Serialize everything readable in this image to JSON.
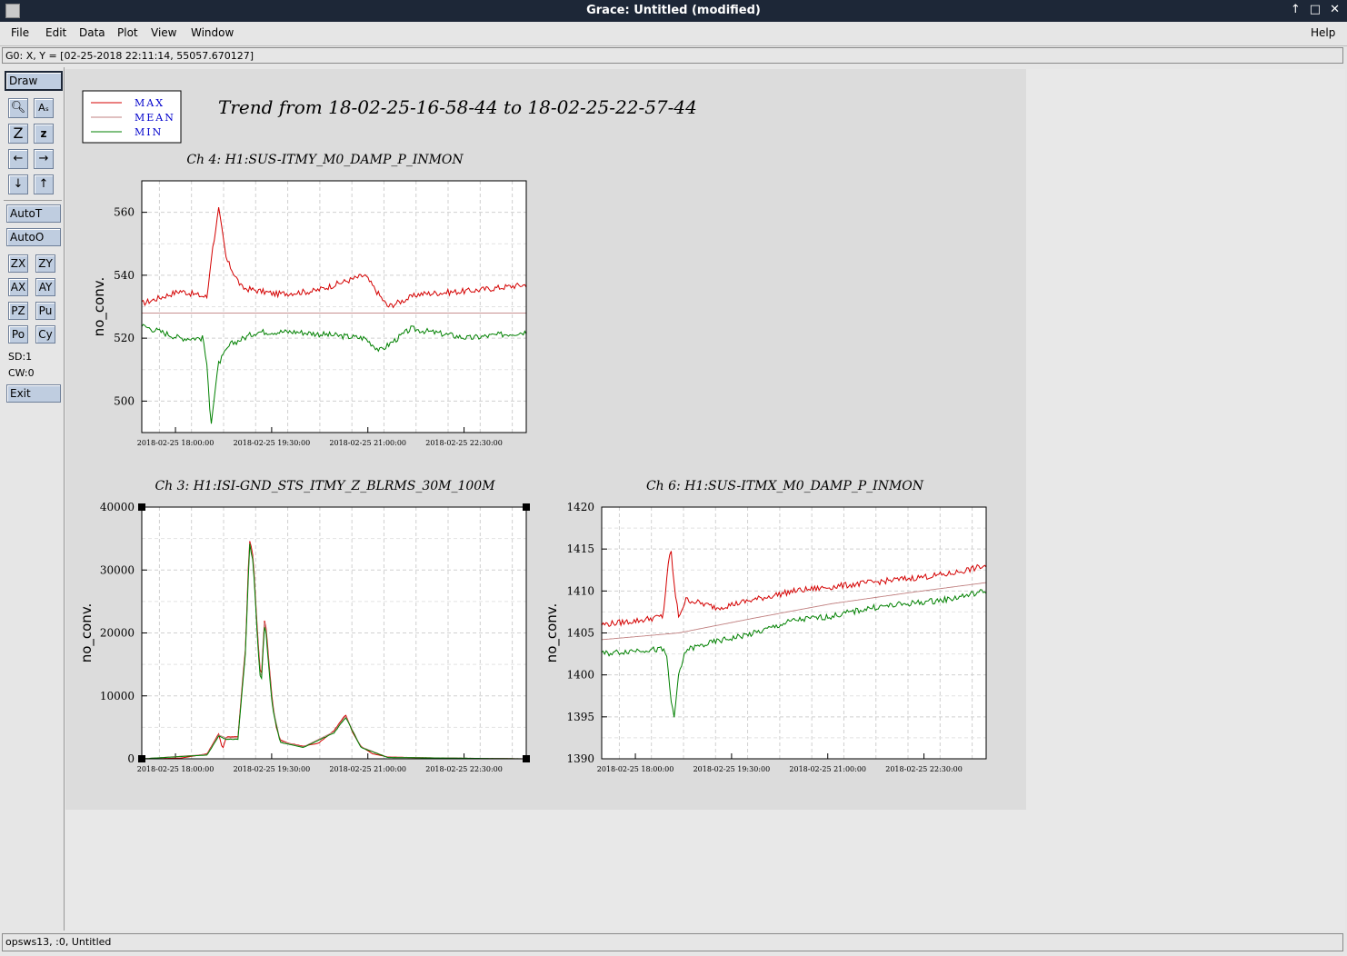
{
  "window": {
    "title": "Grace: Untitled (modified)",
    "controls": [
      "↑",
      "□",
      "✕"
    ]
  },
  "menu": {
    "items": [
      "File",
      "Edit",
      "Data",
      "Plot",
      "View",
      "Window"
    ],
    "help": "Help"
  },
  "locator": "G0: X, Y = [02-25-2018 22:11:14, 55057.670127]",
  "toolbar": {
    "draw": "Draw",
    "autot": "AutoT",
    "autoo": "AutoO",
    "grid_buttons": [
      "ZX",
      "ZY",
      "AX",
      "AY",
      "PZ",
      "Pu",
      "Po",
      "Cy"
    ],
    "sd": "SD:1",
    "cw": "CW:0",
    "exit": "Exit"
  },
  "status": "opsws13, :0, Untitled",
  "legend": {
    "entries": [
      {
        "label": "MAX",
        "color": "#d40000"
      },
      {
        "label": "MEAN",
        "color": "#c08080"
      },
      {
        "label": "MIN",
        "color": "#008000"
      }
    ]
  },
  "page_title": "Trend from 18-02-25-16-58-44 to 18-02-25-22-57-44",
  "chart_data": [
    {
      "type": "line",
      "title": "Ch 4: H1:SUS-ITMY_M0_DAMP_P_INMON",
      "ylabel": "no_conv.",
      "xticks": [
        "2018-02-25 18:00:00",
        "2018-02-25 19:30:00",
        "2018-02-25 21:00:00",
        "2018-02-25 22:30:00"
      ],
      "yticks": [
        500,
        520,
        540,
        560
      ],
      "ylim": [
        490,
        570
      ],
      "xlim": [
        "2018-02-25 16:58:44",
        "2018-02-25 22:57:44"
      ],
      "grid": true,
      "series": [
        {
          "name": "MAX",
          "color": "#d40000",
          "x": [
            0,
            0.1,
            0.17,
            0.18,
            0.2,
            0.22,
            0.26,
            0.35,
            0.45,
            0.58,
            0.64,
            0.72,
            0.85,
            1.0
          ],
          "values": [
            531,
            535,
            533,
            545,
            561,
            545,
            536,
            534,
            535,
            540,
            530,
            534,
            535,
            537
          ]
        },
        {
          "name": "MEAN",
          "color": "#c08080",
          "x": [
            0,
            1.0
          ],
          "values": [
            528,
            528
          ]
        },
        {
          "name": "MIN",
          "color": "#008000",
          "x": [
            0,
            0.1,
            0.16,
            0.17,
            0.18,
            0.2,
            0.23,
            0.3,
            0.4,
            0.58,
            0.62,
            0.7,
            0.85,
            1.0
          ],
          "values": [
            524,
            520,
            520,
            510,
            493,
            512,
            518,
            522,
            522,
            520,
            516,
            523,
            520,
            522
          ]
        }
      ]
    },
    {
      "type": "line",
      "title": "Ch 3: H1:ISI-GND_STS_ITMY_Z_BLRMS_30M_100M",
      "ylabel": "no_conv.",
      "xticks": [
        "2018-02-25 18:00:00",
        "2018-02-25 19:30:00",
        "2018-02-25 21:00:00",
        "2018-02-25 22:30:00"
      ],
      "yticks": [
        0,
        10000,
        20000,
        30000,
        40000
      ],
      "ylim": [
        0,
        40000
      ],
      "xlim": [
        "2018-02-25 16:58:44",
        "2018-02-25 22:57:44"
      ],
      "grid": true,
      "series": [
        {
          "name": "MAX",
          "color": "#d40000",
          "x": [
            0,
            0.1,
            0.17,
            0.2,
            0.21,
            0.22,
            0.25,
            0.27,
            0.28,
            0.29,
            0.3,
            0.31,
            0.32,
            0.33,
            0.34,
            0.35,
            0.36,
            0.38,
            0.42,
            0.46,
            0.5,
            0.53,
            0.55,
            0.57,
            0.6,
            0.64,
            0.7,
            0.8,
            1.0
          ],
          "values": [
            0,
            100,
            800,
            4000,
            1500,
            3500,
            3500,
            18000,
            35000,
            32000,
            21000,
            12000,
            23000,
            16000,
            9000,
            5000,
            3000,
            2500,
            2000,
            2500,
            4500,
            7000,
            4000,
            2000,
            800,
            300,
            200,
            100,
            0
          ]
        },
        {
          "name": "MEAN",
          "color": "#c08080",
          "x": [
            0,
            0.17,
            0.2,
            0.22,
            0.25,
            0.27,
            0.28,
            0.29,
            0.3,
            0.31,
            0.32,
            0.34,
            0.36,
            0.42,
            0.5,
            0.53,
            0.57,
            0.64,
            1.0
          ],
          "values": [
            0,
            700,
            3800,
            3300,
            3300,
            17500,
            34500,
            31500,
            20500,
            11500,
            22500,
            8500,
            2800,
            1900,
            4300,
            6800,
            1900,
            250,
            0
          ]
        },
        {
          "name": "MIN",
          "color": "#008000",
          "x": [
            0,
            0.17,
            0.2,
            0.22,
            0.25,
            0.27,
            0.28,
            0.29,
            0.3,
            0.31,
            0.32,
            0.34,
            0.36,
            0.42,
            0.5,
            0.53,
            0.57,
            0.64,
            1.0
          ],
          "values": [
            0,
            600,
            3600,
            3100,
            3100,
            17000,
            34000,
            31000,
            20000,
            11000,
            22000,
            8000,
            2600,
            1800,
            4100,
            6600,
            1800,
            200,
            0
          ]
        }
      ]
    },
    {
      "type": "line",
      "title": "Ch 6: H1:SUS-ITMX_M0_DAMP_P_INMON",
      "ylabel": "no_conv.",
      "xticks": [
        "2018-02-25 18:00:00",
        "2018-02-25 19:30:00",
        "2018-02-25 21:00:00",
        "2018-02-25 22:30:00"
      ],
      "yticks": [
        1390,
        1395,
        1400,
        1405,
        1410,
        1415,
        1420
      ],
      "ylim": [
        1390,
        1420
      ],
      "xlim": [
        "2018-02-25 16:58:44",
        "2018-02-25 22:57:44"
      ],
      "grid": true,
      "series": [
        {
          "name": "MAX",
          "color": "#d40000",
          "x": [
            0,
            0.1,
            0.16,
            0.17,
            0.18,
            0.19,
            0.2,
            0.22,
            0.3,
            0.4,
            0.5,
            0.6,
            0.7,
            0.8,
            0.9,
            1.0
          ],
          "values": [
            1406,
            1406.5,
            1407,
            1412,
            1415,
            1410,
            1407,
            1409,
            1408,
            1409,
            1410,
            1410.5,
            1411,
            1411.5,
            1412,
            1413
          ]
        },
        {
          "name": "MEAN",
          "color": "#c08080",
          "x": [
            0,
            0.2,
            0.4,
            0.6,
            0.8,
            1.0
          ],
          "values": [
            1404.2,
            1405,
            1406.8,
            1408.5,
            1409.8,
            1411
          ]
        },
        {
          "name": "MIN",
          "color": "#008000",
          "x": [
            0,
            0.1,
            0.16,
            0.17,
            0.18,
            0.19,
            0.2,
            0.22,
            0.3,
            0.4,
            0.5,
            0.6,
            0.7,
            0.8,
            0.9,
            1.0
          ],
          "values": [
            1402.5,
            1403,
            1403,
            1402,
            1397,
            1395,
            1400,
            1403,
            1404,
            1405,
            1406.5,
            1407,
            1408,
            1408.5,
            1409,
            1410
          ]
        }
      ]
    }
  ]
}
